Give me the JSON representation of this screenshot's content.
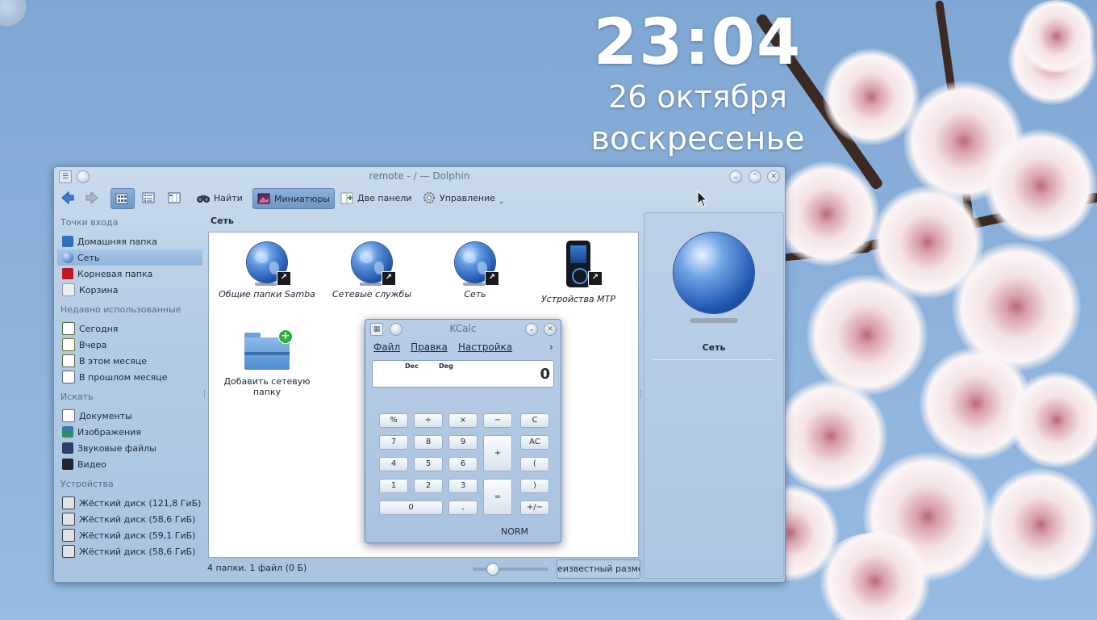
{
  "desktop": {
    "clock": {
      "time": "23:04",
      "date": "26 октября",
      "weekday": "воскресенье"
    }
  },
  "dolphin": {
    "title": "remote - / — Dolphin",
    "toolbar": {
      "find": "Найти",
      "thumbnails": "Миниатюры",
      "split": "Две панели",
      "control": "Управление"
    },
    "places": {
      "sections": [
        {
          "title": "Точки входа",
          "items": [
            "Домашняя папка",
            "Сеть",
            "Корневая папка",
            "Корзина"
          ]
        },
        {
          "title": "Недавно использованные",
          "items": [
            "Сегодня",
            "Вчера",
            "В этом месяце",
            "В прошлом месяце"
          ]
        },
        {
          "title": "Искать",
          "items": [
            "Документы",
            "Изображения",
            "Звуковые файлы",
            "Видео"
          ]
        },
        {
          "title": "Устройства",
          "items": [
            "Жёсткий диск (121,8 ГиБ)",
            "Жёсткий диск (58,6 ГиБ)",
            "Жёсткий диск (59,1 ГиБ)",
            "Жёсткий диск (58,6 ГиБ)"
          ]
        }
      ]
    },
    "location": "Сеть",
    "files": [
      {
        "name": "Общие папки Samba",
        "icon": "globe-link-icon"
      },
      {
        "name": "Сетевые службы",
        "icon": "globe-link-icon"
      },
      {
        "name": "Сеть",
        "icon": "globe-link-icon"
      },
      {
        "name": "Устройства MTP",
        "icon": "media-player-link-icon"
      },
      {
        "name": "Добавить сетевую папку",
        "icon": "add-folder-icon"
      }
    ],
    "status": "4 папки. 1 файл (0 Б)",
    "size_field": "еизвестный разме",
    "info_panel": {
      "name": "Сеть"
    }
  },
  "kcalc": {
    "title": "KCalc",
    "menu": [
      "Файл",
      "Правка",
      "Настройка"
    ],
    "indicators": {
      "base": "Dec",
      "angle": "Deg"
    },
    "display": "0",
    "keys": {
      "percent": "%",
      "divide": "÷",
      "multiply": "×",
      "minus": "−",
      "clear": "C",
      "k7": "7",
      "k8": "8",
      "k9": "9",
      "plus": "+",
      "allclear": "AC",
      "k4": "4",
      "k5": "5",
      "k6": "6",
      "lparen": "(",
      "k1": "1",
      "k2": "2",
      "k3": "3",
      "equals": "=",
      "rparen": ")",
      "k0": "0",
      "comma": ",",
      "plusminus": "+/−"
    },
    "mode": "NORM"
  }
}
